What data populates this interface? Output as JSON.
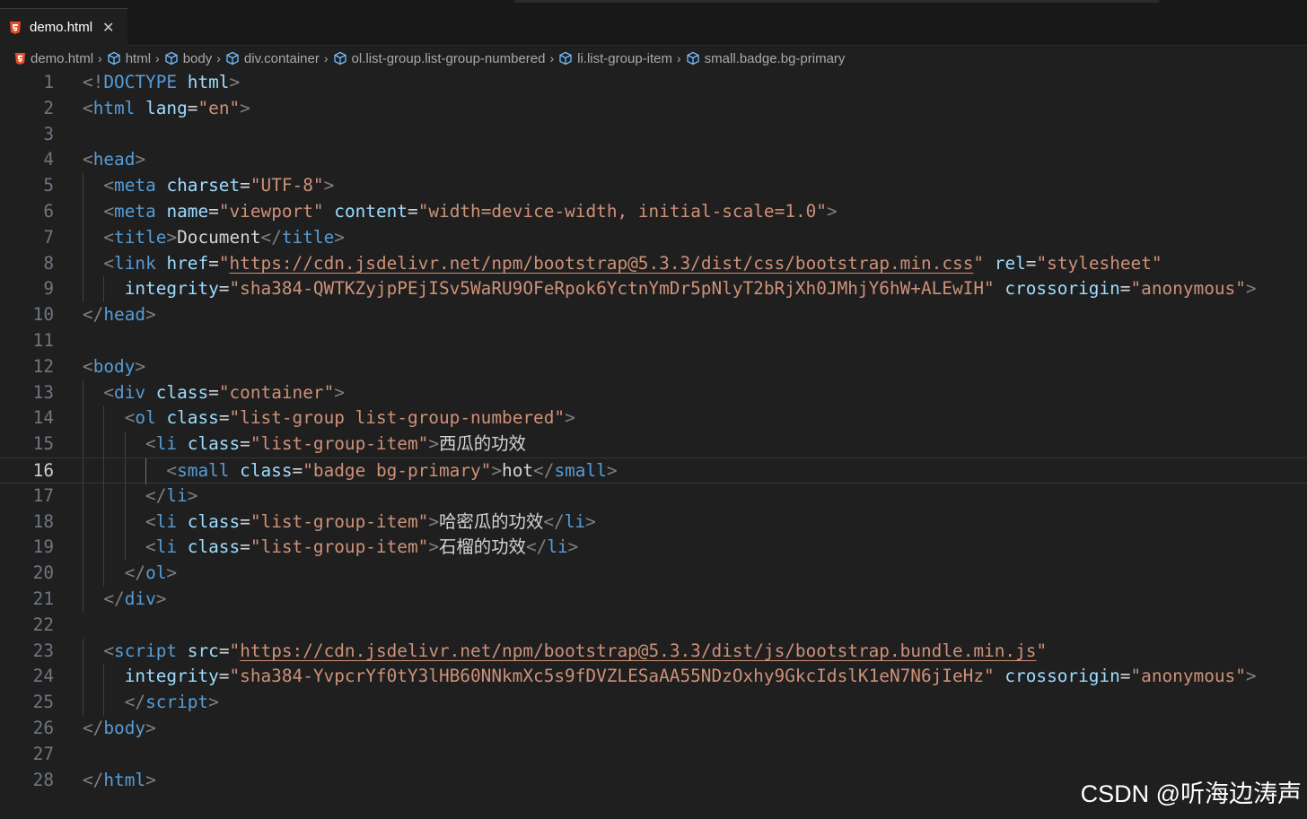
{
  "tab": {
    "filename": "demo.html",
    "close_glyph": "✕"
  },
  "breadcrumb": [
    "demo.html",
    "html",
    "body",
    "div.container",
    "ol.list-group.list-group-numbered",
    "li.list-group-item",
    "small.badge.bg-primary"
  ],
  "editor": {
    "current_line": 16,
    "lines": [
      [
        [
          "ang",
          "<!"
        ],
        [
          "tag",
          "DOCTYPE"
        ],
        [
          "txt",
          " "
        ],
        [
          "attr",
          "html"
        ],
        [
          "ang",
          ">"
        ]
      ],
      [
        [
          "ang",
          "<"
        ],
        [
          "tag",
          "html"
        ],
        [
          "txt",
          " "
        ],
        [
          "attr",
          "lang"
        ],
        [
          "eq",
          "="
        ],
        [
          "str",
          "\"en\""
        ],
        [
          "ang",
          ">"
        ]
      ],
      [],
      [
        [
          "ang",
          "<"
        ],
        [
          "tag",
          "head"
        ],
        [
          "ang",
          ">"
        ]
      ],
      [
        [
          "txt",
          "  "
        ],
        [
          "ang",
          "<"
        ],
        [
          "tag",
          "meta"
        ],
        [
          "txt",
          " "
        ],
        [
          "attr",
          "charset"
        ],
        [
          "eq",
          "="
        ],
        [
          "str",
          "\"UTF-8\""
        ],
        [
          "ang",
          ">"
        ]
      ],
      [
        [
          "txt",
          "  "
        ],
        [
          "ang",
          "<"
        ],
        [
          "tag",
          "meta"
        ],
        [
          "txt",
          " "
        ],
        [
          "attr",
          "name"
        ],
        [
          "eq",
          "="
        ],
        [
          "str",
          "\"viewport\""
        ],
        [
          "txt",
          " "
        ],
        [
          "attr",
          "content"
        ],
        [
          "eq",
          "="
        ],
        [
          "str",
          "\"width=device-width, initial-scale=1.0\""
        ],
        [
          "ang",
          ">"
        ]
      ],
      [
        [
          "txt",
          "  "
        ],
        [
          "ang",
          "<"
        ],
        [
          "tag",
          "title"
        ],
        [
          "ang",
          ">"
        ],
        [
          "txt",
          "Document"
        ],
        [
          "ang",
          "</"
        ],
        [
          "tag",
          "title"
        ],
        [
          "ang",
          ">"
        ]
      ],
      [
        [
          "txt",
          "  "
        ],
        [
          "ang",
          "<"
        ],
        [
          "tag",
          "link"
        ],
        [
          "txt",
          " "
        ],
        [
          "attr",
          "href"
        ],
        [
          "eq",
          "="
        ],
        [
          "str",
          "\""
        ],
        [
          "url",
          "https://cdn.jsdelivr.net/npm/bootstrap@5.3.3/dist/css/bootstrap.min.css"
        ],
        [
          "str",
          "\""
        ],
        [
          "txt",
          " "
        ],
        [
          "attr",
          "rel"
        ],
        [
          "eq",
          "="
        ],
        [
          "str",
          "\"stylesheet\""
        ]
      ],
      [
        [
          "txt",
          "    "
        ],
        [
          "attr",
          "integrity"
        ],
        [
          "eq",
          "="
        ],
        [
          "str",
          "\"sha384-QWTKZyjpPEjISv5WaRU9OFeRpok6YctnYmDr5pNlyT2bRjXh0JMhjY6hW+ALEwIH\""
        ],
        [
          "txt",
          " "
        ],
        [
          "attr",
          "crossorigin"
        ],
        [
          "eq",
          "="
        ],
        [
          "str",
          "\"anonymous\""
        ],
        [
          "ang",
          ">"
        ]
      ],
      [
        [
          "ang",
          "</"
        ],
        [
          "tag",
          "head"
        ],
        [
          "ang",
          ">"
        ]
      ],
      [],
      [
        [
          "ang",
          "<"
        ],
        [
          "tag",
          "body"
        ],
        [
          "ang",
          ">"
        ]
      ],
      [
        [
          "txt",
          "  "
        ],
        [
          "ang",
          "<"
        ],
        [
          "tag",
          "div"
        ],
        [
          "txt",
          " "
        ],
        [
          "attr",
          "class"
        ],
        [
          "eq",
          "="
        ],
        [
          "str",
          "\"container\""
        ],
        [
          "ang",
          ">"
        ]
      ],
      [
        [
          "txt",
          "    "
        ],
        [
          "ang",
          "<"
        ],
        [
          "tag",
          "ol"
        ],
        [
          "txt",
          " "
        ],
        [
          "attr",
          "class"
        ],
        [
          "eq",
          "="
        ],
        [
          "str",
          "\"list-group list-group-numbered\""
        ],
        [
          "ang",
          ">"
        ]
      ],
      [
        [
          "txt",
          "      "
        ],
        [
          "ang",
          "<"
        ],
        [
          "tag",
          "li"
        ],
        [
          "txt",
          " "
        ],
        [
          "attr",
          "class"
        ],
        [
          "eq",
          "="
        ],
        [
          "str",
          "\"list-group-item\""
        ],
        [
          "ang",
          ">"
        ],
        [
          "txt",
          "西瓜的功效"
        ]
      ],
      [
        [
          "txt",
          "        "
        ],
        [
          "ang",
          "<"
        ],
        [
          "tag",
          "small"
        ],
        [
          "txt",
          " "
        ],
        [
          "attr",
          "class"
        ],
        [
          "eq",
          "="
        ],
        [
          "str",
          "\"badge bg-primary\""
        ],
        [
          "ang",
          ">"
        ],
        [
          "txt",
          "hot"
        ],
        [
          "ang",
          "</"
        ],
        [
          "tag",
          "small"
        ],
        [
          "ang",
          ">"
        ]
      ],
      [
        [
          "txt",
          "      "
        ],
        [
          "ang",
          "</"
        ],
        [
          "tag",
          "li"
        ],
        [
          "ang",
          ">"
        ]
      ],
      [
        [
          "txt",
          "      "
        ],
        [
          "ang",
          "<"
        ],
        [
          "tag",
          "li"
        ],
        [
          "txt",
          " "
        ],
        [
          "attr",
          "class"
        ],
        [
          "eq",
          "="
        ],
        [
          "str",
          "\"list-group-item\""
        ],
        [
          "ang",
          ">"
        ],
        [
          "txt",
          "哈密瓜的功效"
        ],
        [
          "ang",
          "</"
        ],
        [
          "tag",
          "li"
        ],
        [
          "ang",
          ">"
        ]
      ],
      [
        [
          "txt",
          "      "
        ],
        [
          "ang",
          "<"
        ],
        [
          "tag",
          "li"
        ],
        [
          "txt",
          " "
        ],
        [
          "attr",
          "class"
        ],
        [
          "eq",
          "="
        ],
        [
          "str",
          "\"list-group-item\""
        ],
        [
          "ang",
          ">"
        ],
        [
          "txt",
          "石榴的功效"
        ],
        [
          "ang",
          "</"
        ],
        [
          "tag",
          "li"
        ],
        [
          "ang",
          ">"
        ]
      ],
      [
        [
          "txt",
          "    "
        ],
        [
          "ang",
          "</"
        ],
        [
          "tag",
          "ol"
        ],
        [
          "ang",
          ">"
        ]
      ],
      [
        [
          "txt",
          "  "
        ],
        [
          "ang",
          "</"
        ],
        [
          "tag",
          "div"
        ],
        [
          "ang",
          ">"
        ]
      ],
      [],
      [
        [
          "txt",
          "  "
        ],
        [
          "ang",
          "<"
        ],
        [
          "tag",
          "script"
        ],
        [
          "txt",
          " "
        ],
        [
          "attr",
          "src"
        ],
        [
          "eq",
          "="
        ],
        [
          "str",
          "\""
        ],
        [
          "url",
          "https://cdn.jsdelivr.net/npm/bootstrap@5.3.3/dist/js/bootstrap.bundle.min.js"
        ],
        [
          "str",
          "\""
        ]
      ],
      [
        [
          "txt",
          "    "
        ],
        [
          "attr",
          "integrity"
        ],
        [
          "eq",
          "="
        ],
        [
          "str",
          "\"sha384-YvpcrYf0tY3lHB60NNkmXc5s9fDVZLESaAA55NDzOxhy9GkcIdslK1eN7N6jIeHz\""
        ],
        [
          "txt",
          " "
        ],
        [
          "attr",
          "crossorigin"
        ],
        [
          "eq",
          "="
        ],
        [
          "str",
          "\"anonymous\""
        ],
        [
          "ang",
          ">"
        ]
      ],
      [
        [
          "txt",
          "    "
        ],
        [
          "ang",
          "</"
        ],
        [
          "tag",
          "script"
        ],
        [
          "ang",
          ">"
        ]
      ],
      [
        [
          "ang",
          "</"
        ],
        [
          "tag",
          "body"
        ],
        [
          "ang",
          ">"
        ]
      ],
      [],
      [
        [
          "ang",
          "</"
        ],
        [
          "tag",
          "html"
        ],
        [
          "ang",
          ">"
        ]
      ]
    ]
  },
  "watermark": "CSDN @听海边涛声",
  "colors": {
    "tag": "#569cd6",
    "attribute": "#9cdcfe",
    "string": "#ce9178",
    "bracket": "#808080",
    "text": "#d4d4d4",
    "html5_icon": "#e44d26"
  },
  "icons": {
    "file": "html5-icon",
    "element": "cube-icon",
    "separator": "chevron-right-icon",
    "close": "close-icon"
  }
}
